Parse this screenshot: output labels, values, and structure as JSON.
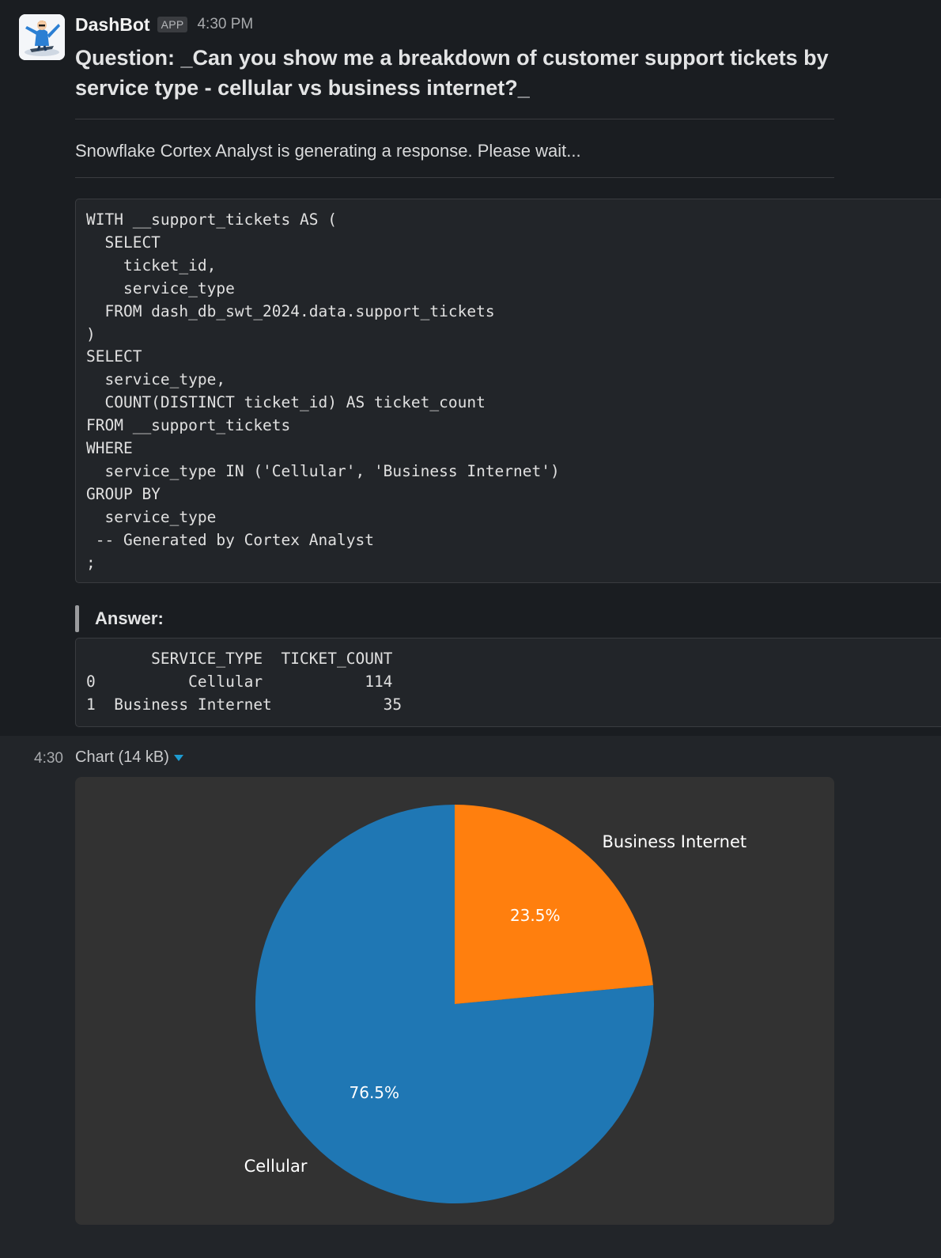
{
  "message": {
    "bot_name": "DashBot",
    "badge": "APP",
    "time": "4:30 PM",
    "question": "Question: _Can you show me a breakdown of customer support tickets by service type - cellular vs business internet?_",
    "status": "Snowflake Cortex Analyst is generating a response. Please wait...",
    "sql_code": "WITH __support_tickets AS (\n  SELECT\n    ticket_id,\n    service_type\n  FROM dash_db_swt_2024.data.support_tickets\n)\nSELECT\n  service_type,\n  COUNT(DISTINCT ticket_id) AS ticket_count\nFROM __support_tickets\nWHERE\n  service_type IN ('Cellular', 'Business Internet')\nGROUP BY\n  service_type\n -- Generated by Cortex Analyst\n;",
    "answer_label": "Answer:",
    "answer_table": "       SERVICE_TYPE  TICKET_COUNT\n0          Cellular           114\n1  Business Internet            35"
  },
  "attachment": {
    "time": "4:30",
    "title": "Chart (14 kB)"
  },
  "colors": {
    "cellular": "#1f77b4",
    "business_internet": "#ff7f0e",
    "chart_bg": "#323232",
    "accent": "#1d9bd1"
  },
  "chart_data": {
    "type": "pie",
    "categories": [
      "Cellular",
      "Business Internet"
    ],
    "values": [
      114,
      35
    ],
    "percent_labels": [
      "76.5%",
      "23.5%"
    ],
    "start_angle_deg": 90,
    "direction": "counterclockwise-from-top"
  }
}
